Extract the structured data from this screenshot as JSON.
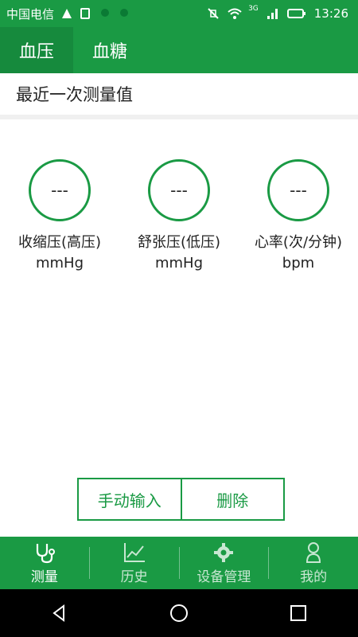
{
  "status_bar": {
    "carrier": "中国电信",
    "network": "3G",
    "time": "13:26"
  },
  "tabs": [
    {
      "label": "血压",
      "active": true
    },
    {
      "label": "血糖",
      "active": false
    }
  ],
  "section": {
    "title": "最近一次测量值"
  },
  "metrics": [
    {
      "value": "---",
      "label": "收缩压(高压)",
      "unit": "mmHg"
    },
    {
      "value": "---",
      "label": "舒张压(低压)",
      "unit": "mmHg"
    },
    {
      "value": "---",
      "label": "心率(次/分钟)",
      "unit": "bpm"
    }
  ],
  "actions": {
    "manual_input": "手动输入",
    "delete": "删除"
  },
  "bottom_nav": [
    {
      "label": "测量",
      "icon": "stethoscope-icon",
      "active": true
    },
    {
      "label": "历史",
      "icon": "chart-icon",
      "active": false
    },
    {
      "label": "设备管理",
      "icon": "gear-icon",
      "active": false
    },
    {
      "label": "我的",
      "icon": "person-icon",
      "active": false
    }
  ],
  "colors": {
    "primary": "#1a9a44",
    "primary_dark": "#168a3d"
  }
}
